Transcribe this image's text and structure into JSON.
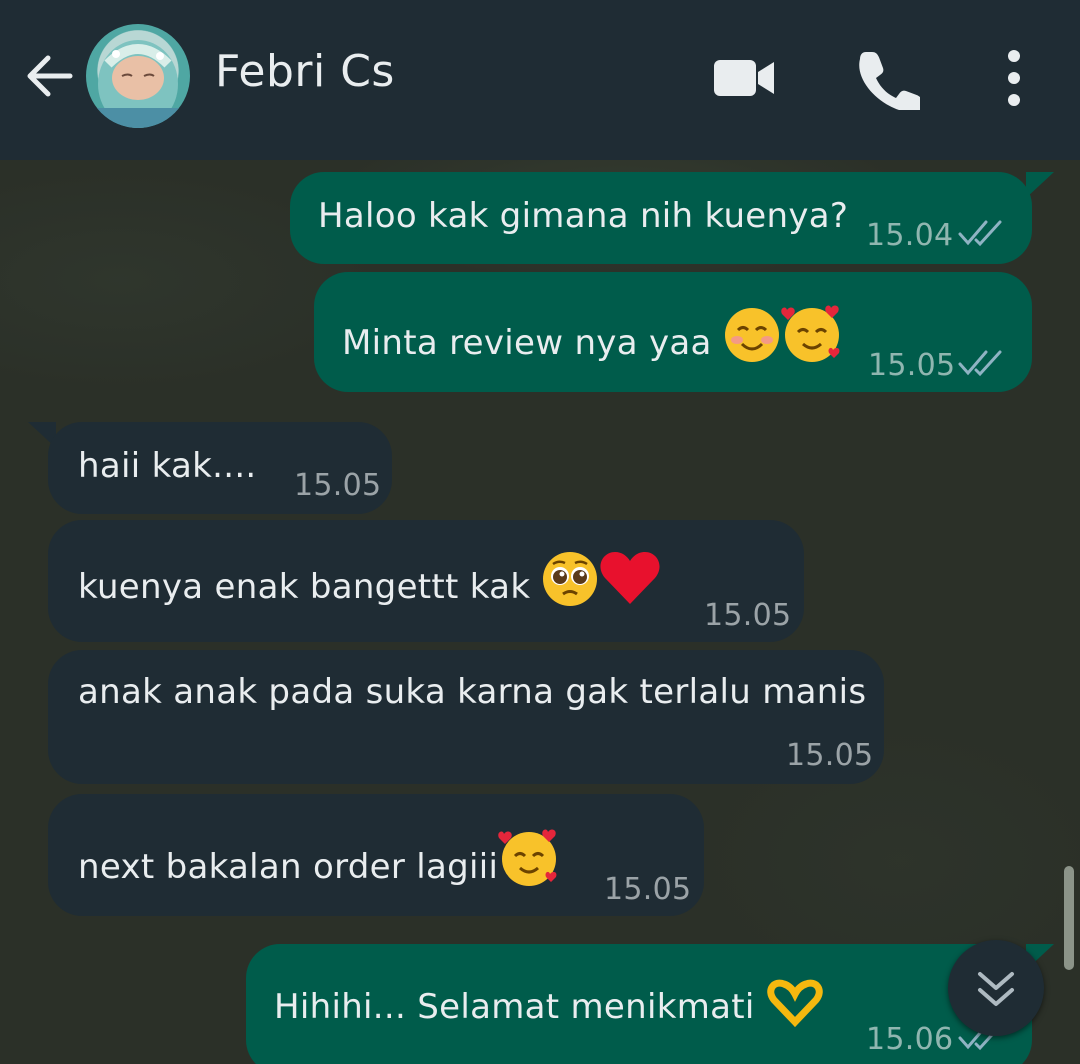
{
  "header": {
    "contact_name": "Febri Cs",
    "icons": [
      "back-arrow-icon",
      "video-call-icon",
      "voice-call-icon",
      "more-options-icon"
    ]
  },
  "messages": [
    {
      "direction": "outgoing",
      "text": "Haloo kak gimana nih kuenya?",
      "time": "15.04",
      "status": "read"
    },
    {
      "direction": "outgoing",
      "text": "Minta review nya yaa",
      "emojis": [
        "smiling-blush-emoji",
        "smiling-hearts-emoji"
      ],
      "time": "15.05",
      "status": "read"
    },
    {
      "direction": "incoming",
      "text": "haii kak....",
      "time": "15.05"
    },
    {
      "direction": "incoming",
      "text": "kuenya enak bangettt kak",
      "emojis": [
        "pleading-face-emoji",
        "red-heart-emoji"
      ],
      "time": "15.05"
    },
    {
      "direction": "incoming",
      "text": "anak anak pada suka karna gak terlalu manis",
      "time": "15.05"
    },
    {
      "direction": "incoming",
      "text": "next bakalan order lagiii",
      "emojis": [
        "smiling-hearts-emoji"
      ],
      "time": "15.05"
    },
    {
      "direction": "outgoing",
      "text": "Hihihi... Selamat menikmati",
      "emojis": [
        "heart-hands-emoji"
      ],
      "time": "15.06",
      "status": "read"
    }
  ],
  "colors": {
    "header_bg": "#1f2c34",
    "outgoing_bubble": "#005c4b",
    "incoming_bubble": "#1f2c34",
    "read_tick": "#8fb3c3"
  }
}
